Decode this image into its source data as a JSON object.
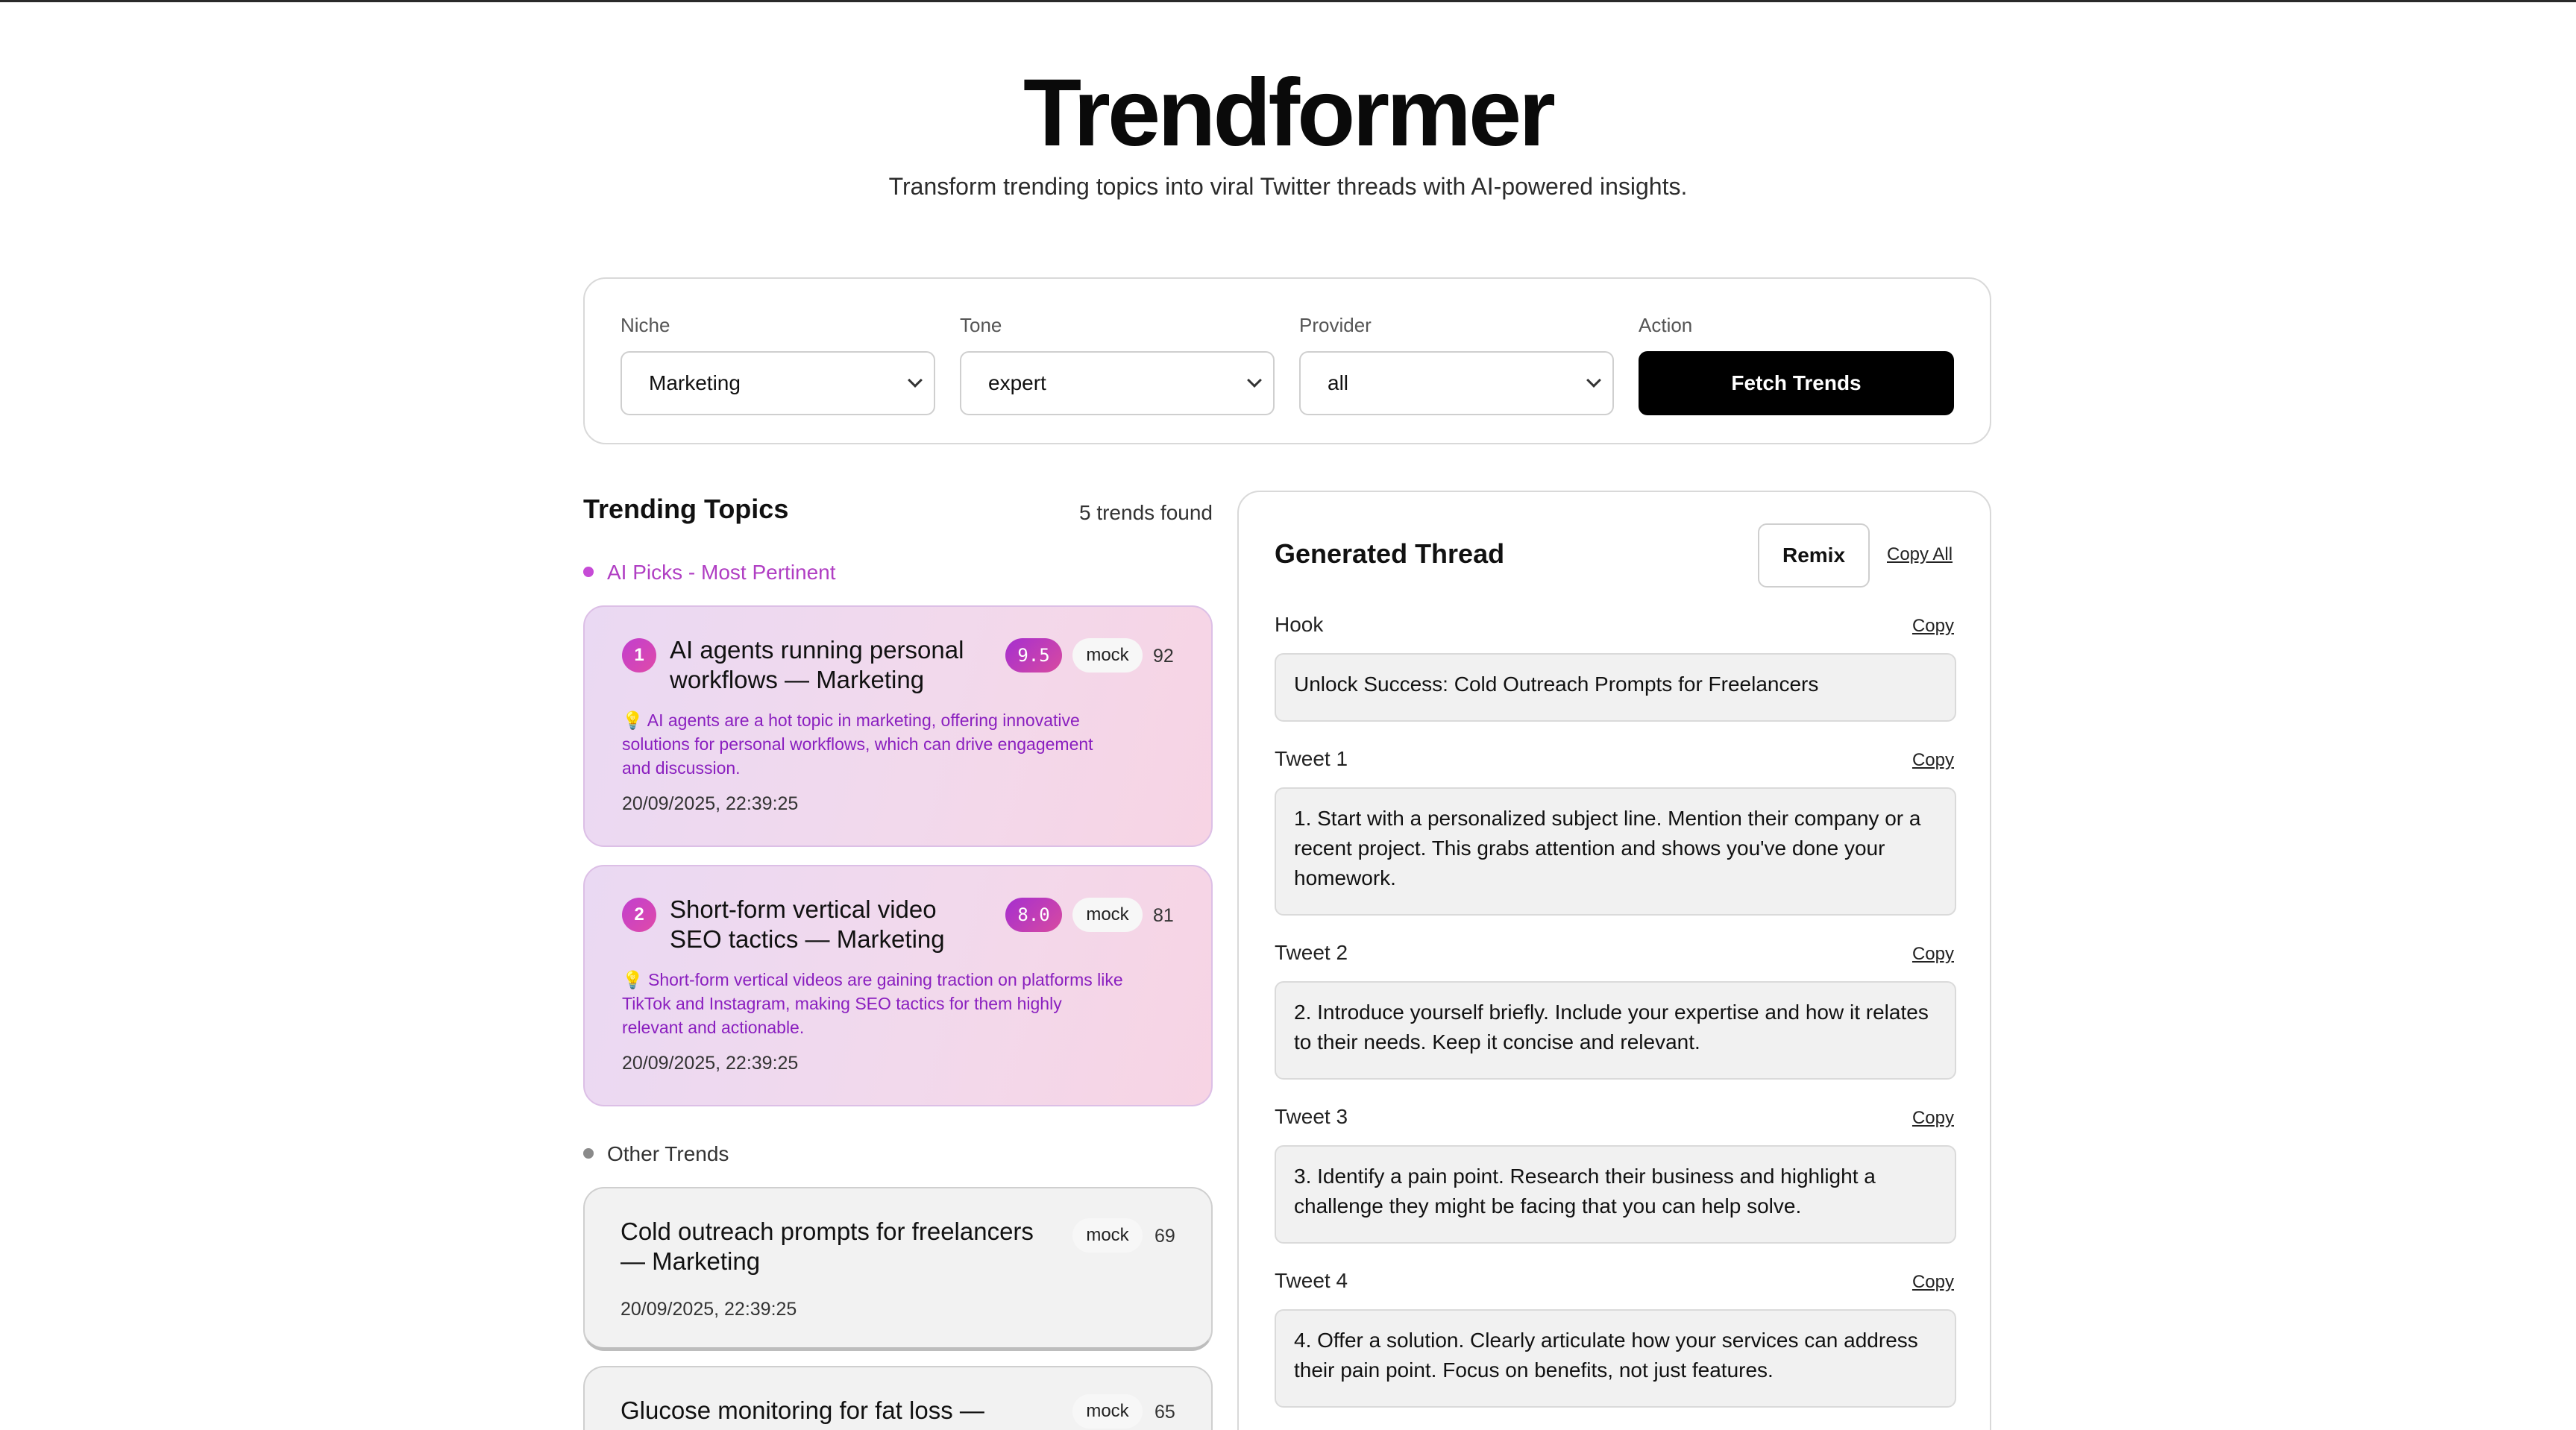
{
  "header": {
    "title": "Trendformer",
    "subtitle": "Transform trending topics into viral Twitter threads with AI-powered insights."
  },
  "controls": {
    "niche": {
      "label": "Niche",
      "value": "Marketing"
    },
    "tone": {
      "label": "Tone",
      "value": "expert"
    },
    "provider": {
      "label": "Provider",
      "value": "all"
    },
    "action": {
      "label": "Action",
      "button": "Fetch Trends"
    }
  },
  "trends": {
    "title": "Trending Topics",
    "count_text": "5 trends found",
    "ai_picks_label": "AI Picks - Most Pertinent",
    "other_label": "Other Trends",
    "picks": [
      {
        "rank": "1",
        "title_line1": "AI agents running personal",
        "title_line2": "workflows — Marketing",
        "score": "9.5",
        "source": "mock",
        "num": "92",
        "reason_line1": "💡 AI agents are a hot topic in marketing, offering innovative",
        "reason_line2": "solutions for personal workflows, which can drive engagement",
        "reason_line3": "and discussion.",
        "timestamp": "20/09/2025, 22:39:25"
      },
      {
        "rank": "2",
        "title_line1": "Short-form vertical video",
        "title_line2": "SEO tactics — Marketing",
        "score": "8.0",
        "source": "mock",
        "num": "81",
        "reason_line1": "💡 Short-form vertical videos are gaining traction on platforms like",
        "reason_line2": "TikTok and Instagram, making SEO tactics for them highly",
        "reason_line3": "relevant and actionable.",
        "timestamp": "20/09/2025, 22:39:25"
      }
    ],
    "others": [
      {
        "title_line1": "Cold outreach prompts for freelancers",
        "title_line2": "— Marketing",
        "source": "mock",
        "num": "69",
        "timestamp": "20/09/2025, 22:39:25"
      },
      {
        "title_line1": "Glucose monitoring for fat loss —",
        "source": "mock",
        "num": "65"
      }
    ]
  },
  "thread": {
    "title": "Generated Thread",
    "remix_label": "Remix",
    "copy_all_label": "Copy All",
    "copy_label": "Copy",
    "hook": {
      "label": "Hook",
      "text": "Unlock Success: Cold Outreach Prompts for Freelancers"
    },
    "tweets": [
      {
        "label": "Tweet 1",
        "text": "1. Start with a personalized subject line. Mention their company or a recent project. This grabs attention and shows you've done your homework."
      },
      {
        "label": "Tweet 2",
        "text": "2. Introduce yourself briefly. Include your expertise and how it relates to their needs. Keep it concise and relevant."
      },
      {
        "label": "Tweet 3",
        "text": "3. Identify a pain point. Research their business and highlight a challenge they might be facing that you can help solve."
      },
      {
        "label": "Tweet 4",
        "text": "4. Offer a solution. Clearly articulate how your services can address their pain point. Focus on benefits, not just features."
      }
    ]
  },
  "colors": {
    "accent_purple": "#8a1fbf",
    "dot_pink": "#c64bd6",
    "dot_gray": "#8a8a8a"
  }
}
